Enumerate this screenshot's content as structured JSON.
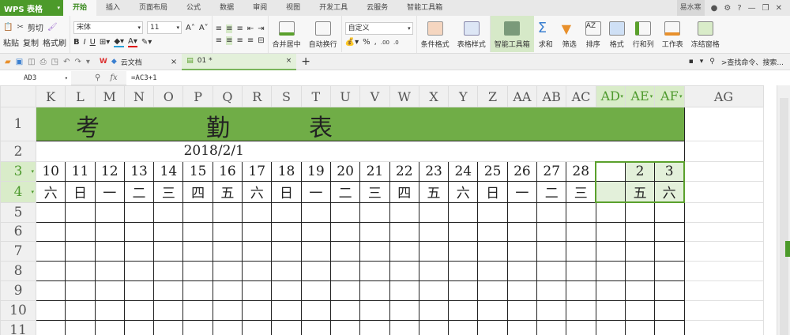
{
  "app": {
    "name": "WPS 表格",
    "user": "易水寒"
  },
  "menu_tabs": [
    "开始",
    "插入",
    "页面布局",
    "公式",
    "数据",
    "审阅",
    "视图",
    "开发工具",
    "云服务",
    "智能工具箱"
  ],
  "active_tab": "开始",
  "ribbon": {
    "paste": "粘贴",
    "cut": "剪切",
    "copy": "复制",
    "format_painter": "格式刷",
    "font_name": "宋体",
    "font_size": "11",
    "bold": "B",
    "italic": "I",
    "underline": "U",
    "merge_center": "合并居中",
    "wrap_text": "自动换行",
    "number_format": "自定义",
    "conditional_format": "条件格式",
    "table_style": "表格样式",
    "smart_toolbox": "智能工具箱",
    "sum": "求和",
    "filter": "筛选",
    "sort": "排序",
    "format": "格式",
    "rows_cols": "行和列",
    "worksheet": "工作表",
    "freeze": "冻结窗格"
  },
  "doc_tabs": {
    "cloud": "云文档",
    "file": "01 *"
  },
  "search_placeholder": ">查找命令、搜索...",
  "formula_bar": {
    "name_box": "AD3",
    "formula": "=AC3+1"
  },
  "sheet": {
    "columns": [
      "K",
      "L",
      "M",
      "N",
      "O",
      "P",
      "Q",
      "R",
      "S",
      "T",
      "U",
      "V",
      "W",
      "X",
      "Y",
      "Z",
      "AA",
      "AB",
      "AC",
      "AD",
      "AE",
      "AF",
      "AG"
    ],
    "selected_columns": [
      "AD",
      "AE",
      "AF"
    ],
    "rows": [
      "1",
      "2",
      "3",
      "4",
      "5",
      "6",
      "7",
      "8",
      "9",
      "10",
      "11"
    ],
    "selected_rows": [
      "3",
      "4"
    ],
    "title_chars": [
      "考",
      "勤",
      "表"
    ],
    "date": "2018/2/1",
    "days": [
      "10",
      "11",
      "12",
      "13",
      "14",
      "15",
      "16",
      "17",
      "18",
      "19",
      "20",
      "21",
      "22",
      "23",
      "24",
      "25",
      "26",
      "27",
      "28",
      "",
      "2",
      "3"
    ],
    "weekdays": [
      "六",
      "日",
      "一",
      "二",
      "三",
      "四",
      "五",
      "六",
      "日",
      "一",
      "二",
      "三",
      "四",
      "五",
      "六",
      "日",
      "一",
      "二",
      "三",
      "",
      "五",
      "六"
    ]
  },
  "colors": {
    "accent": "#4c9a2a",
    "title_fill": "#70ad47",
    "selection": "#e3f0da"
  }
}
